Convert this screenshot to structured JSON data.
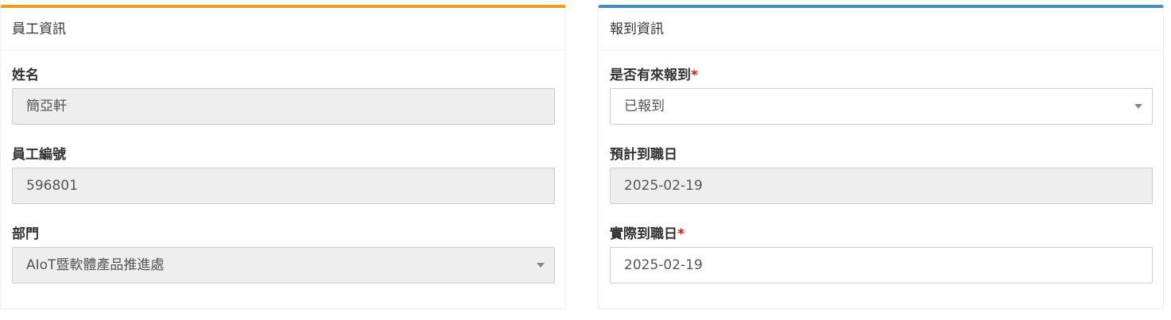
{
  "employee_panel": {
    "title": "員工資訊",
    "accent_color": "#e69f24",
    "fields": {
      "name": {
        "label": "姓名",
        "value": "簡亞軒"
      },
      "employee_id": {
        "label": "員工編號",
        "value": "596801"
      },
      "department": {
        "label": "部門",
        "value": "AIoT暨軟體產品推進處"
      }
    }
  },
  "checkin_panel": {
    "title": "報到資訊",
    "accent_color": "#4a8ab6",
    "fields": {
      "checked_in": {
        "label": "是否有來報到",
        "required_mark": "*",
        "value": "已報到"
      },
      "expected_start_date": {
        "label": "預計到職日",
        "value": "2025-02-19"
      },
      "actual_start_date": {
        "label": "實際到職日",
        "required_mark": "*",
        "value": "2025-02-19"
      }
    }
  },
  "colors": {
    "required": "#dd1515",
    "disabled_bg": "#eeeeee"
  }
}
